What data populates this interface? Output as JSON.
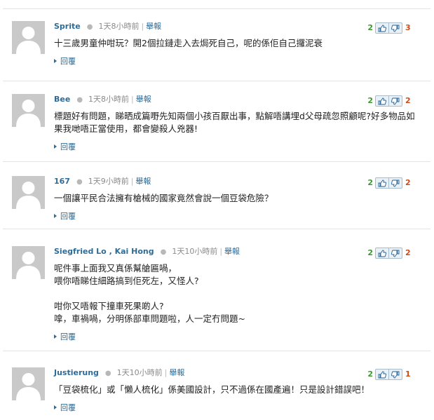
{
  "comments": [
    {
      "name": "Sprite",
      "time": "1天8小時前",
      "report": "舉報",
      "lines": [
        "十三歲男童仲咁玩？開2個拉鏈走入去焗死自己，呢的係佢自己攞泥衰"
      ],
      "reply": "回覆",
      "up": "2",
      "down": "3"
    },
    {
      "name": "Bee",
      "time": "1天8小時前",
      "report": "舉報",
      "lines": [
        "標題好有問題，睇晒成篇嘢先知兩個小孩百厭出事，點解唔講埋d父母疏忽照顧呢?好多物品如",
        "果我哋唔正當使用，都會變殺人兇器!"
      ],
      "reply": "回覆",
      "up": "2",
      "down": "2"
    },
    {
      "name": "167",
      "time": "1天9小時前",
      "report": "舉報",
      "lines": [
        "一個讓平民合法擁有槍械的國家竟然會說一個豆袋危險？"
      ],
      "reply": "回覆",
      "up": "2",
      "down": "2"
    },
    {
      "name": "Siegfried Lo , Kai Hong",
      "time": "1天10小時前",
      "report": "舉報",
      "lines": [
        "呢件事上面我又真係幫艙匾喎，",
        "喂你唔睇住細路搞到佢死左，又怪人?",
        "",
        "咁你又唔報下撞車死果啲人?",
        "嗱，車禍喎，分明係部車問題啦，人一定冇問題~"
      ],
      "reply": "回覆",
      "up": "2",
      "down": "2"
    },
    {
      "name": "Justierung",
      "time": "1天10小時前",
      "report": "舉報",
      "lines": [
        "「豆袋梳化」或「懶人梳化」係美國設計，只不過係在國產遍！只是設計錯誤吧！"
      ],
      "reply": "回覆",
      "up": "2",
      "down": "1"
    }
  ],
  "icons": {
    "avatar": "default-avatar-icon",
    "vote_up": "thumbs-up-icon",
    "vote_down": "thumbs-down-icon",
    "reply_arrow": "triangle-right-icon"
  },
  "colors": {
    "link": "#2e6c97",
    "up_count": "#3c9a2f",
    "down_count": "#d04a14"
  }
}
